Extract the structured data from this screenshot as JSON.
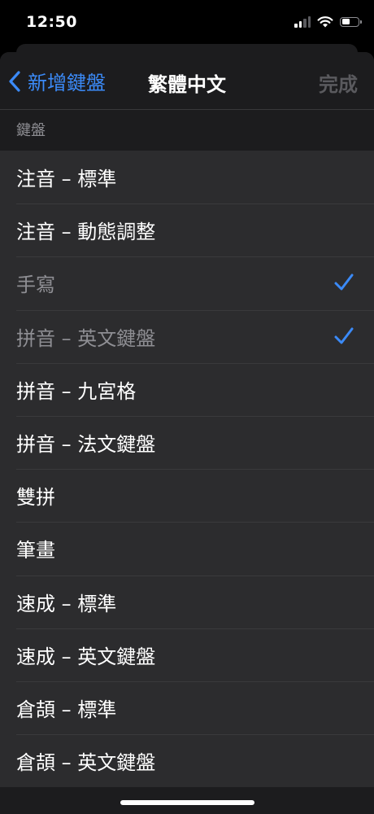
{
  "status_bar": {
    "time": "12:50",
    "icons": [
      "cellular-signal-icon",
      "wifi-icon",
      "battery-icon"
    ],
    "battery_level": 0.55
  },
  "nav": {
    "back_label": "新增鍵盤",
    "title": "繁體中文",
    "done_label": "完成"
  },
  "section": {
    "header": "鍵盤"
  },
  "keyboards": [
    {
      "label": "注音 – 標準",
      "checked": false
    },
    {
      "label": "注音 – 動態調整",
      "checked": false
    },
    {
      "label": "手寫",
      "checked": true
    },
    {
      "label": "拼音 – 英文鍵盤",
      "checked": true
    },
    {
      "label": "拼音 – 九宮格",
      "checked": false
    },
    {
      "label": "拼音 – 法文鍵盤",
      "checked": false
    },
    {
      "label": "雙拼",
      "checked": false
    },
    {
      "label": "筆畫",
      "checked": false
    },
    {
      "label": "速成 – 標準",
      "checked": false
    },
    {
      "label": "速成 – 英文鍵盤",
      "checked": false
    },
    {
      "label": "倉頡 – 標準",
      "checked": false
    },
    {
      "label": "倉頡 – 英文鍵盤",
      "checked": false
    }
  ],
  "colors": {
    "accent": "#3b8af7",
    "background": "#000000",
    "sheet": "#1c1c1e",
    "row": "#2c2c2e",
    "secondary_text": "#8e8e93"
  }
}
